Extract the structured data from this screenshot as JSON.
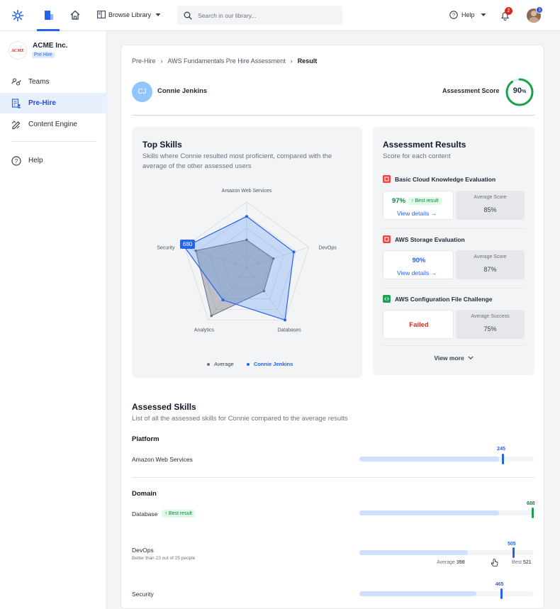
{
  "topbar": {
    "browse_label": "Browse Library",
    "search_placeholder": "Search in our library...",
    "help_label": "Help",
    "notifications_count": "2",
    "avatar_badge": "3"
  },
  "sidebar": {
    "company_name": "ACME Inc.",
    "company_logo_text": "ACME",
    "company_tag": "Pre Hire",
    "items": [
      {
        "label": "Teams"
      },
      {
        "label": "Pre-Hire"
      },
      {
        "label": "Content Engine"
      },
      {
        "label": "Help"
      }
    ]
  },
  "breadcrumb": {
    "items": [
      "Pre-Hire",
      "AWS Fundamentals Pre Hire Assessment"
    ],
    "current": "Result"
  },
  "candidate": {
    "initials": "CJ",
    "name": "Connie Jenkins",
    "score_label": "Assessment Score",
    "score_value": "90",
    "score_unit": "%",
    "score_fraction": 0.9
  },
  "top_skills": {
    "title": "Top Skills",
    "subtitle_line1": "Skills where Connie resulted most proficient, compared with the",
    "subtitle_line2": "average of the other assessed users",
    "tooltip_value": "680",
    "legend_average": "Average",
    "legend_candidate": "Connie Jenkins"
  },
  "chart_data": {
    "type": "radar",
    "axes": [
      "Amazon Web Services",
      "DevOps",
      "Databases",
      "Analytics",
      "Security"
    ],
    "series": [
      {
        "name": "Average",
        "values": [
          0.42,
          0.43,
          0.45,
          0.92,
          0.82
        ]
      },
      {
        "name": "Connie Jenkins",
        "values": [
          0.78,
          0.76,
          1.0,
          0.62,
          1.0
        ]
      }
    ],
    "range": [
      0,
      1
    ],
    "colors": {
      "average": "#6b7280",
      "candidate": "#2563eb"
    }
  },
  "assessment_results": {
    "title": "Assessment Results",
    "subtitle": "Score for each content",
    "items": [
      {
        "title": "Basic Cloud Knowledge Evaluation",
        "score": "97%",
        "badge": "Best result",
        "link": "View details →",
        "avg_label": "Average Score",
        "avg_value": "85%"
      },
      {
        "title": "AWS Storage Evaluation",
        "score": "90%",
        "link": "View details →",
        "avg_label": "Average Score",
        "avg_value": "87%"
      },
      {
        "title": "AWS Configuration File Challenge",
        "score": "Failed",
        "avg_label": "Average Success",
        "avg_value": "75%"
      }
    ],
    "view_more": "View more"
  },
  "assessed_skills": {
    "title": "Assessed Skills",
    "subtitle": "List of all the assessed skills for Connie compared to the average results",
    "groups": [
      {
        "name": "Platform",
        "skills": [
          {
            "name": "Amazon Web Services",
            "value": "245",
            "avg_fraction": 0.8,
            "value_fraction": 0.83
          }
        ]
      },
      {
        "name": "Domain",
        "skills": [
          {
            "name": "Database",
            "badge": "Best result",
            "value": "688",
            "avg_fraction": 0.8,
            "value_fraction": 1.0
          },
          {
            "name": "DevOps",
            "detail": "Better than 23 out of 25 people",
            "value": "505",
            "avg_fraction": 0.62,
            "value_fraction": 0.89,
            "avg_label": "Average",
            "avg_value": "398",
            "best_label": "Best",
            "best_value": "521"
          },
          {
            "name": "Security",
            "value": "465",
            "avg_fraction": 0.67,
            "value_fraction": 0.82
          }
        ]
      }
    ]
  },
  "colors": {
    "primary": "#2563eb",
    "success": "#16a34a",
    "danger": "#dc2626"
  }
}
